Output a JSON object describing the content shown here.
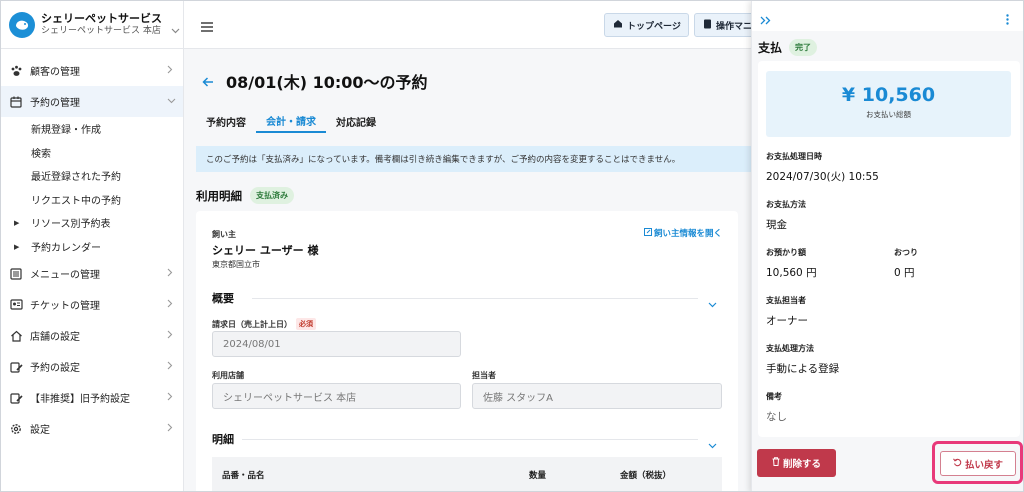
{
  "sidebar": {
    "brand_name": "シェリーペットサービス",
    "brand_sub": "シェリーペットサービス 本店",
    "items": [
      {
        "label": "顧客の管理"
      },
      {
        "label": "予約の管理"
      },
      {
        "label": "メニューの管理"
      },
      {
        "label": "チケットの管理"
      },
      {
        "label": "店舗の設定"
      },
      {
        "label": "予約の設定"
      },
      {
        "label": "【非推奨】旧予約設定"
      },
      {
        "label": "設定"
      }
    ],
    "sub_items": [
      {
        "label": "新規登録・作成"
      },
      {
        "label": "検索"
      },
      {
        "label": "最近登録された予約"
      },
      {
        "label": "リクエスト中の予約"
      },
      {
        "label": "リソース別予約表"
      },
      {
        "label": "予約カレンダー"
      }
    ]
  },
  "topbar": {
    "top_page": "トップページ",
    "manual": "操作マニュアル"
  },
  "main": {
    "title": "08/01(木) 10:00〜の予約",
    "tabs": [
      {
        "label": "予約内容"
      },
      {
        "label": "会計・請求"
      },
      {
        "label": "対応記録"
      }
    ],
    "notice": "このご予約は「支払済み」になっています。備考欄は引き続き編集できますが、ご予約の内容を変更することはできません。",
    "section_title": "利用明細",
    "section_badge": "支払済み",
    "owner_label": "飼い主",
    "owner_link": "飼い主情報を開く",
    "owner_name": "シェリー ユーザー 様",
    "owner_address": "東京都国立市",
    "overview_title": "概要",
    "bill_date_label": "請求日（売上計上日）",
    "required": "必須",
    "bill_date_value": "2024/08/01",
    "store_label": "利用店舗",
    "store_value": "シェリーペットサービス 本店",
    "staff_label": "担当者",
    "staff_value": "佐藤 スタッフA",
    "detail_title": "明細",
    "table_headers": [
      "品番・品名",
      "数量",
      "金額（税抜）"
    ]
  },
  "panel": {
    "title": "支払",
    "status": "完了",
    "amount": "¥ 10,560",
    "amount_caption": "お支払い総額",
    "fields": {
      "datetime_label": "お支払処理日時",
      "datetime_value": "2024/07/30(火) 10:55",
      "method_label": "お支払方法",
      "method_value": "現金",
      "deposit_label": "お預かり額",
      "deposit_value": "10,560 円",
      "change_label": "おつり",
      "change_value": "0 円",
      "staff_label": "支払担当者",
      "staff_value": "オーナー",
      "process_label": "支払処理方法",
      "process_value": "手動による登録",
      "note_label": "備考",
      "note_value": "なし"
    },
    "delete_button": "削除する",
    "refund_button": "払い戻す"
  },
  "colors": {
    "accent": "#1a8ad4",
    "danger": "#c0394b",
    "highlight": "#e8397a",
    "success_bg": "#dff1e0"
  }
}
